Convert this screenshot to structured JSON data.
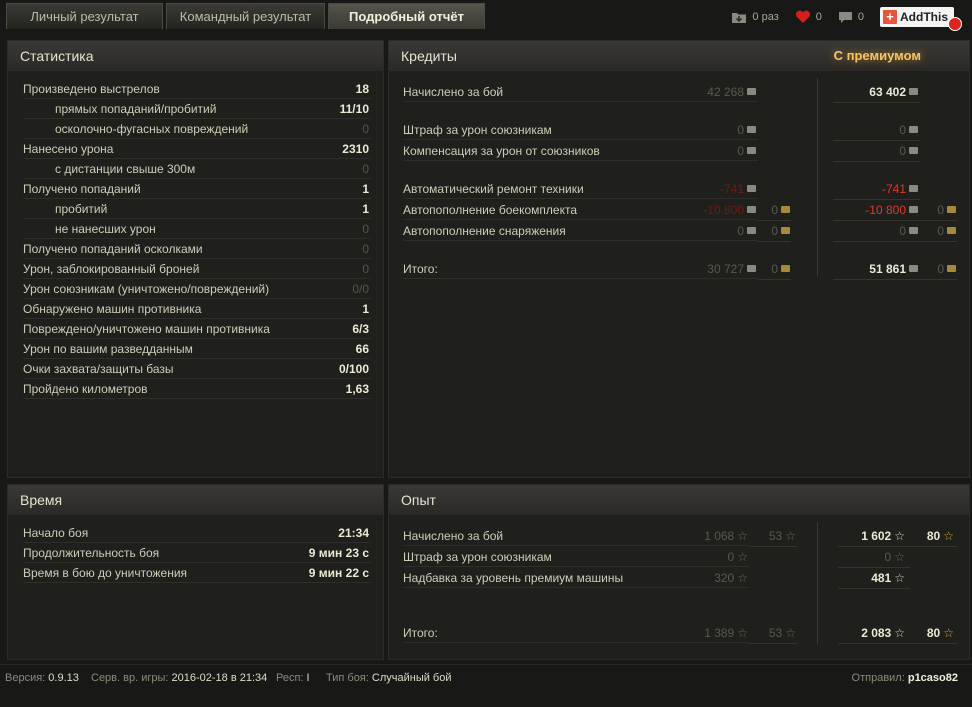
{
  "tabs": [
    {
      "label": "Личный результат"
    },
    {
      "label": "Командный результат"
    },
    {
      "label": "Подробный отчёт"
    }
  ],
  "toolbar": {
    "times_count": "0 раз",
    "likes_count": "0",
    "comments_count": "0",
    "addthis_label": "AddThis"
  },
  "stats": {
    "title": "Статистика",
    "rows": [
      {
        "label": "Произведено выстрелов",
        "value": "18"
      },
      {
        "label": "прямых попаданий/пробитий",
        "value": "11/10"
      },
      {
        "label": "осколочно-фугасных повреждений",
        "value": "0"
      },
      {
        "label": "Нанесено урона",
        "value": "2310"
      },
      {
        "label": "с дистанции свыше 300м",
        "value": "0"
      },
      {
        "label": "Получено попаданий",
        "value": "1"
      },
      {
        "label": "пробитий",
        "value": "1"
      },
      {
        "label": "не нанесших урон",
        "value": "0"
      },
      {
        "label": "Получено попаданий осколками",
        "value": "0"
      },
      {
        "label": "Урон, заблокированный броней",
        "value": "0"
      },
      {
        "label": "Урон союзникам (уничтожено/повреждений)",
        "value": "0/0"
      },
      {
        "label": "Обнаружено машин противника",
        "value": "1"
      },
      {
        "label": "Повреждено/уничтожено машин противника",
        "value": "6/3"
      },
      {
        "label": "Урон по вашим разведданным",
        "value": "66"
      },
      {
        "label": "Очки захвата/защиты базы",
        "value": "0/100"
      },
      {
        "label": "Пройдено километров",
        "value": "1,63"
      }
    ]
  },
  "credits": {
    "title": "Кредиты",
    "premium_title": "С премиумом",
    "rows": [
      {
        "label": "Начислено за бой",
        "base": "42 268",
        "base_gold": "",
        "prem": "63 402",
        "prem_gold": ""
      },
      {
        "label": "Штраф за урон союзникам",
        "base": "0",
        "base_gold": "",
        "prem": "0",
        "prem_gold": ""
      },
      {
        "label": "Компенсация за урон от союзников",
        "base": "0",
        "base_gold": "",
        "prem": "0",
        "prem_gold": ""
      },
      {
        "label": "Автоматический ремонт техники",
        "base": "-741",
        "base_gold": "",
        "prem": "-741",
        "prem_gold": ""
      },
      {
        "label": "Автопополнение боекомплекта",
        "base": "-10 800",
        "base_gold": "0",
        "prem": "-10 800",
        "prem_gold": "0"
      },
      {
        "label": "Автопополнение снаряжения",
        "base": "0",
        "base_gold": "0",
        "prem": "0",
        "prem_gold": "0"
      },
      {
        "label": "Итого:",
        "base": "30 727",
        "base_gold": "0",
        "prem": "51 861",
        "prem_gold": "0"
      }
    ]
  },
  "time": {
    "title": "Время",
    "rows": [
      {
        "label": "Начало боя",
        "value": "21:34"
      },
      {
        "label": "Продолжительность боя",
        "value": "9 мин 23 с"
      },
      {
        "label": "Время в бою до уничтожения",
        "value": "9 мин 22 с"
      }
    ]
  },
  "xp": {
    "title": "Опыт",
    "rows": [
      {
        "label": "Начислено за бой",
        "base": "1 068",
        "base_free": "53",
        "prem": "1 602",
        "prem_free": "80"
      },
      {
        "label": "Штраф за урон союзникам",
        "base": "0",
        "base_free": "",
        "prem": "0",
        "prem_free": ""
      },
      {
        "label": "Надбавка за уровень премиум машины",
        "base": "320",
        "base_free": "",
        "prem": "481",
        "prem_free": ""
      },
      {
        "label": "Итого:",
        "base": "1 389",
        "base_free": "53",
        "prem": "2 083",
        "prem_free": "80"
      }
    ]
  },
  "footer": {
    "version_label": "Версия:",
    "version": "0.9.13",
    "server_time_label": "Серв. вр. игры:",
    "server_time": "2016-02-18 в 21:34",
    "resp_label": "Респ:",
    "resp": "I",
    "battle_type_label": "Тип боя:",
    "battle_type": "Случайный бой",
    "sender_label": "Отправил:",
    "sender": "p1caso82"
  },
  "colors": {
    "accent_gold": "#f6c46a",
    "negative": "#e03a2a",
    "background": "#181816"
  }
}
